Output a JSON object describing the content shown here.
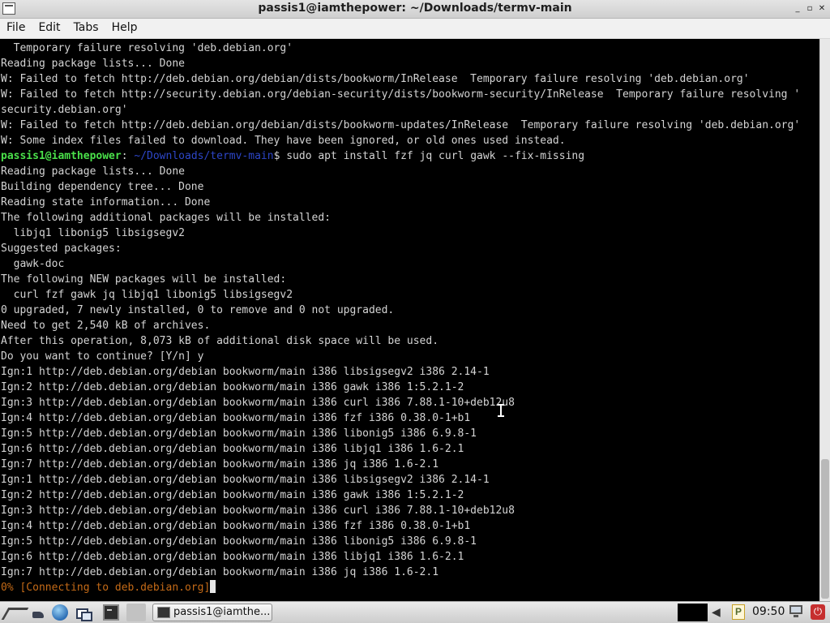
{
  "window": {
    "title": "passis1@iamthepower: ~/Downloads/termv-main",
    "controls": [
      "_",
      "▫",
      "✕"
    ]
  },
  "menu": [
    "File",
    "Edit",
    "Tabs",
    "Help"
  ],
  "prompt": {
    "user": "passis1@iamthepower",
    "path": "~/Downloads/termv-main",
    "command": "$ sudo apt install fzf jq curl gawk --fix-missing"
  },
  "terminal_lines": [
    "  Temporary failure resolving 'deb.debian.org'",
    "Reading package lists... Done",
    "W: Failed to fetch http://deb.debian.org/debian/dists/bookworm/InRelease  Temporary failure resolving 'deb.debian.org'",
    "W: Failed to fetch http://security.debian.org/debian-security/dists/bookworm-security/InRelease  Temporary failure resolving '",
    "security.debian.org'",
    "W: Failed to fetch http://deb.debian.org/debian/dists/bookworm-updates/InRelease  Temporary failure resolving 'deb.debian.org'",
    "W: Some index files failed to download. They have been ignored, or old ones used instead.",
    "",
    "Reading package lists... Done",
    "Building dependency tree... Done",
    "Reading state information... Done",
    "The following additional packages will be installed:",
    "  libjq1 libonig5 libsigsegv2",
    "Suggested packages:",
    "  gawk-doc",
    "The following NEW packages will be installed:",
    "  curl fzf gawk jq libjq1 libonig5 libsigsegv2",
    "0 upgraded, 7 newly installed, 0 to remove and 0 not upgraded.",
    "Need to get 2,540 kB of archives.",
    "After this operation, 8,073 kB of additional disk space will be used.",
    "Do you want to continue? [Y/n] y",
    "Ign:1 http://deb.debian.org/debian bookworm/main i386 libsigsegv2 i386 2.14-1",
    "Ign:2 http://deb.debian.org/debian bookworm/main i386 gawk i386 1:5.2.1-2",
    "Ign:3 http://deb.debian.org/debian bookworm/main i386 curl i386 7.88.1-10+deb12u8",
    "Ign:4 http://deb.debian.org/debian bookworm/main i386 fzf i386 0.38.0-1+b1",
    "Ign:5 http://deb.debian.org/debian bookworm/main i386 libonig5 i386 6.9.8-1",
    "Ign:6 http://deb.debian.org/debian bookworm/main i386 libjq1 i386 1.6-2.1",
    "Ign:7 http://deb.debian.org/debian bookworm/main i386 jq i386 1.6-2.1",
    "Ign:1 http://deb.debian.org/debian bookworm/main i386 libsigsegv2 i386 2.14-1",
    "Ign:2 http://deb.debian.org/debian bookworm/main i386 gawk i386 1:5.2.1-2",
    "Ign:3 http://deb.debian.org/debian bookworm/main i386 curl i386 7.88.1-10+deb12u8",
    "Ign:4 http://deb.debian.org/debian bookworm/main i386 fzf i386 0.38.0-1+b1",
    "Ign:5 http://deb.debian.org/debian bookworm/main i386 libonig5 i386 6.9.8-1",
    "Ign:6 http://deb.debian.org/debian bookworm/main i386 libjq1 i386 1.6-2.1",
    "Ign:7 http://deb.debian.org/debian bookworm/main i386 jq i386 1.6-2.1"
  ],
  "progress_line": "0% [Connecting to deb.debian.org]",
  "colors": {
    "prompt_user": "#4ae04a",
    "prompt_path": "#2d46c8",
    "progress": "#c46a17",
    "terminal_text": "#d4d4d4",
    "terminal_bg": "#000000"
  },
  "taskbar": {
    "task_label": "passis1@iamthe...",
    "clock": "09:50",
    "p_label": "P",
    "icons": [
      "app-menu-icon",
      "file-manager-icon",
      "web-browser-icon",
      "show-desktop-icon",
      "terminal-icon"
    ]
  }
}
